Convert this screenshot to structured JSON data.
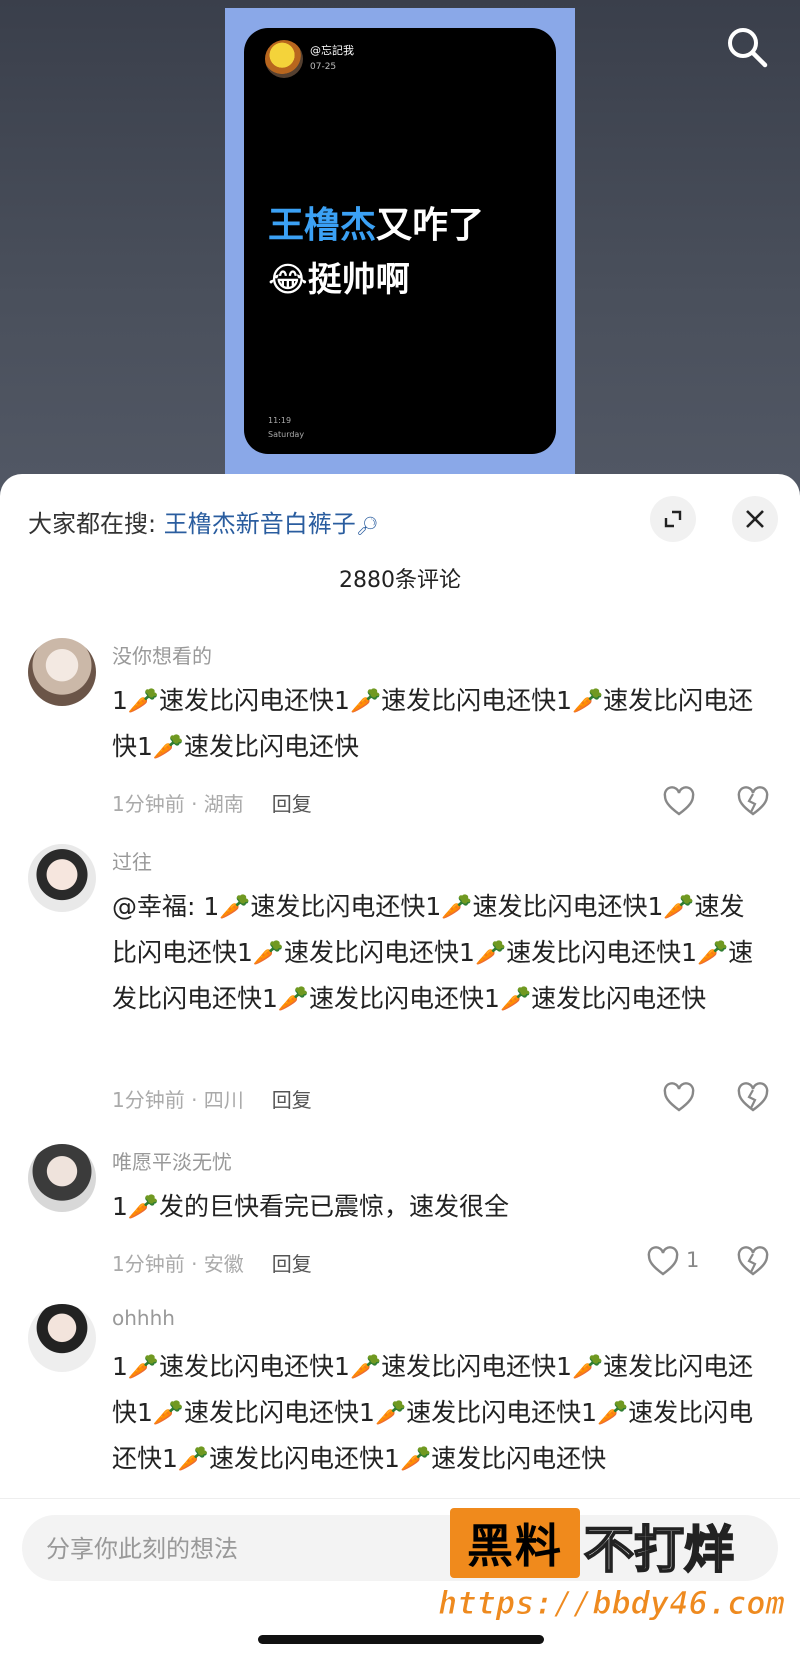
{
  "video": {
    "username": "@忘記我",
    "date": "07-25",
    "headline_highlight": "王橹杰",
    "headline_rest": "又咋了",
    "subline_emoji": "😂",
    "subline_text": "挺帅啊",
    "lock_time": "11:19",
    "lock_day": "Saturday"
  },
  "sheet": {
    "search_prefix": "大家都在搜: ",
    "search_term": "王橹杰新音白裤子",
    "comment_count": "2880条评论"
  },
  "comments": [
    {
      "name": "没你想看的",
      "text": "1🥕速发比闪电还快1🥕速发比闪电还快1🥕速发比闪电还快1🥕速发比闪电还快",
      "meta": "1分钟前 · 湖南",
      "reply": "回复",
      "likes": ""
    },
    {
      "name": "过往",
      "text": "@幸福: 1🥕速发比闪电还快1🥕速发比闪电还快1🥕速发比闪电还快1🥕速发比闪电还快1🥕速发比闪电还快1🥕速发比闪电还快1🥕速发比闪电还快1🥕速发比闪电还快",
      "meta": "1分钟前 · 四川",
      "reply": "回复",
      "likes": ""
    },
    {
      "name": "唯愿平淡无忧",
      "text": "1🥕发的巨快看完已震惊，速发很全",
      "meta": "1分钟前 · 安徽",
      "reply": "回复",
      "likes": "1"
    },
    {
      "name": "ohhhh",
      "text": "1🥕速发比闪电还快1🥕速发比闪电还快1🥕速发比闪电还快1🥕速发比闪电还快1🥕速发比闪电还快1🥕速发比闪电还快1🥕速发比闪电还快1🥕速发比闪电还快"
    }
  ],
  "input": {
    "placeholder": "分享你此刻的想法"
  },
  "watermark": {
    "badge": "黑料",
    "text": "不打烊",
    "url": "https://bbdy46.com"
  }
}
